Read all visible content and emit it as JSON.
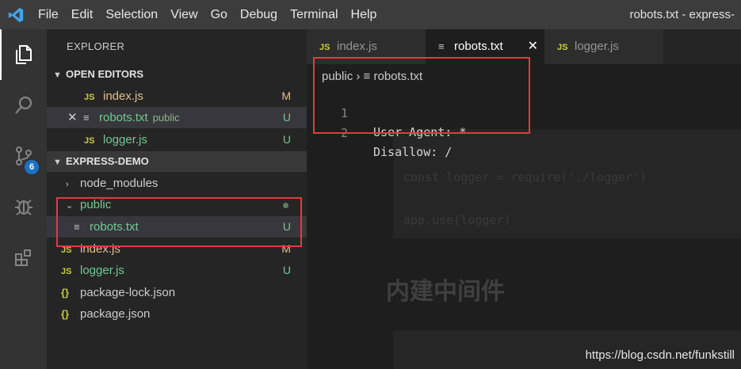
{
  "titlebar": {
    "menu": [
      "File",
      "Edit",
      "Selection",
      "View",
      "Go",
      "Debug",
      "Terminal",
      "Help"
    ],
    "window_title": "robots.txt - express-"
  },
  "activity": {
    "icons": [
      "files-icon",
      "search-icon",
      "source-control-icon",
      "debug-icon",
      "extensions-icon"
    ],
    "scm_badge": "6"
  },
  "sidebar": {
    "title": "EXPLORER",
    "open_editors": {
      "header": "OPEN EDITORS",
      "items": [
        {
          "icon": "JS",
          "name": "index.js",
          "path": "",
          "status": "M"
        },
        {
          "icon": "txt",
          "name": "robots.txt",
          "path": "public",
          "status": "U"
        },
        {
          "icon": "JS",
          "name": "logger.js",
          "path": "",
          "status": "U"
        }
      ]
    },
    "project": {
      "header": "EXPRESS-DEMO",
      "items": [
        {
          "name": "node_modules",
          "status": ""
        },
        {
          "name": "public",
          "status": ""
        },
        {
          "name": "robots.txt",
          "status": "U"
        },
        {
          "icon": "JS",
          "name": "index.js",
          "status": "M"
        },
        {
          "icon": "JS",
          "name": "logger.js",
          "status": "U"
        },
        {
          "icon": "{}",
          "name": "package-lock.json",
          "status": ""
        },
        {
          "icon": "{}",
          "name": "package.json",
          "status": ""
        }
      ]
    }
  },
  "tabs": [
    {
      "icon": "JS",
      "label": "index.js"
    },
    {
      "icon": "txt",
      "label": "robots.txt"
    },
    {
      "icon": "JS",
      "label": "logger.js"
    }
  ],
  "breadcrumb": {
    "folder": "public",
    "file": "robots.txt"
  },
  "editor": {
    "lines": [
      {
        "number": "1",
        "text": "User-Agent: *"
      },
      {
        "number": "2",
        "text": "Disallow: /"
      }
    ]
  },
  "background": {
    "code1": "const logger = require('./logger')",
    "code2": "app.use(logger)",
    "heading": "内建中间件"
  },
  "watermark": "https://blog.csdn.net/funkstill",
  "colors": {
    "highlight_box": "#e03c3c",
    "git_modified": "#e2c08d",
    "git_untracked": "#73c991"
  }
}
